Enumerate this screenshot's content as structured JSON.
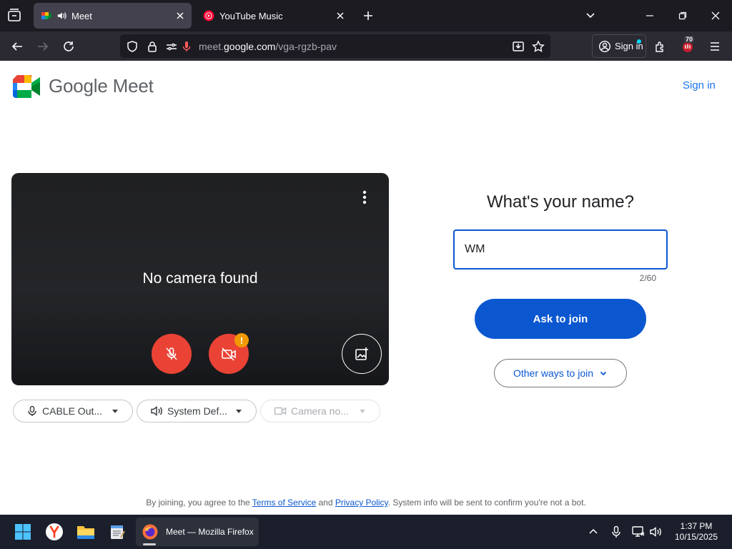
{
  "browser": {
    "tabs": [
      {
        "title": "Meet",
        "active": true,
        "playing_audio": true
      },
      {
        "title": "YouTube Music",
        "active": false
      }
    ],
    "url": {
      "prefix": "meet.",
      "host": "google.com",
      "path": "/vga-rgzb-pav"
    },
    "signin_label": "Sign in",
    "extension_badge": "70"
  },
  "page": {
    "brand": "Google Meet",
    "header_signin": "Sign in",
    "preview": {
      "message": "No camera found"
    },
    "devices": [
      {
        "label": "CABLE Out...",
        "icon": "microphone-icon",
        "enabled": true
      },
      {
        "label": "System Def...",
        "icon": "speaker-icon",
        "enabled": true
      },
      {
        "label": "Camera no...",
        "icon": "camera-icon",
        "enabled": false
      }
    ],
    "join": {
      "title": "What's your name?",
      "name_value": "WM",
      "counter": "2/60",
      "ask_label": "Ask to join",
      "other_label": "Other ways to join"
    },
    "legal": {
      "prefix": "By joining, you agree to the ",
      "terms": "Terms of Service",
      "and": " and ",
      "privacy": "Privacy Policy",
      "suffix": ". System info will be sent to confirm you're not a bot."
    }
  },
  "taskbar": {
    "active_app": "Meet — Mozilla Firefox",
    "time": "1:37 PM",
    "date": "10/15/2025"
  },
  "colors": {
    "accent": "#0b57d0",
    "danger": "#ea4335",
    "warning": "#f29900",
    "browser_dark": "#1c1b22"
  }
}
